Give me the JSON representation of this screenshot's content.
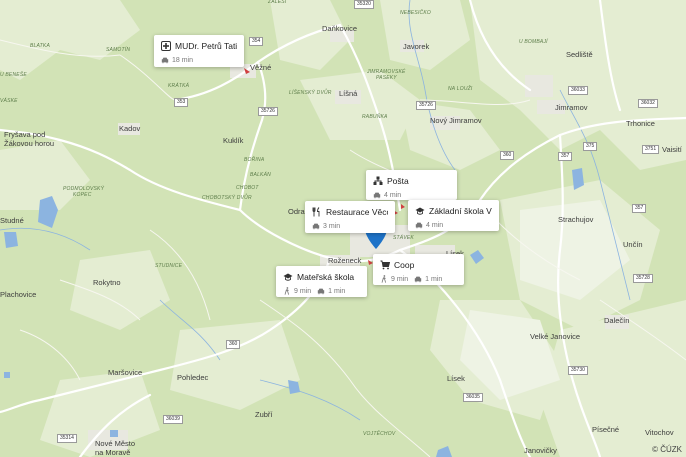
{
  "towns": [
    {
      "id": "dankovice",
      "text": "Daňkovice"
    },
    {
      "id": "javorek",
      "text": "Javorek"
    },
    {
      "id": "sedliste",
      "text": "Sedliště"
    },
    {
      "id": "kadov",
      "text": "Kadov"
    },
    {
      "id": "liskaovice",
      "text": "Líšná"
    },
    {
      "id": "novy-jimramov",
      "text": "Nový Jimramov"
    },
    {
      "id": "jimramov",
      "text": "Jimramov"
    },
    {
      "id": "trhonice",
      "text": "Trhonice"
    },
    {
      "id": "vaisiti",
      "text": "Vaisití"
    },
    {
      "id": "frysava",
      "text": "Fryšava pod"
    },
    {
      "id": "zakova",
      "text": "Žákovou horou"
    },
    {
      "id": "kuklik",
      "text": "Kuklík"
    },
    {
      "id": "odra",
      "text": "Odra"
    },
    {
      "id": "strachujov",
      "text": "Strachujov"
    },
    {
      "id": "uncin",
      "text": "Unčín"
    },
    {
      "id": "rokytno",
      "text": "Rokytno"
    },
    {
      "id": "plachovice",
      "text": "Plachovice"
    },
    {
      "id": "studne",
      "text": "Studné"
    },
    {
      "id": "rozenecky",
      "text": "Roženeck"
    },
    {
      "id": "lisek-top",
      "text": "Lísek"
    },
    {
      "id": "lisek",
      "text": "Lísek"
    },
    {
      "id": "velke-janovice",
      "text": "Velké Janovice"
    },
    {
      "id": "dalecin",
      "text": "Dalečín"
    },
    {
      "id": "marsovice",
      "text": "Maršovice"
    },
    {
      "id": "pohledec",
      "text": "Pohledec"
    },
    {
      "id": "zubri",
      "text": "Zubří"
    },
    {
      "id": "nove-mesto",
      "text": "Nové Město"
    },
    {
      "id": "na-morave",
      "text": "na Moravě"
    },
    {
      "id": "janovicky",
      "text": "Janovičky"
    },
    {
      "id": "pisecne",
      "text": "Písečné"
    },
    {
      "id": "vitochov",
      "text": "Vitochov"
    },
    {
      "id": "vezne",
      "text": "Věžné"
    }
  ],
  "areas": [
    {
      "id": "samotin",
      "text": "SAMOTÍN"
    },
    {
      "id": "blatka",
      "text": "BLATKA"
    },
    {
      "id": "zalesi",
      "text": "ZÁLESÍ"
    },
    {
      "id": "nebesicko",
      "text": "NEBESIČKO"
    },
    {
      "id": "jimram-pasek",
      "text": "JIMRAMOVSKÉ"
    },
    {
      "id": "jimram-pasek2",
      "text": "PASEKY"
    },
    {
      "id": "na-louzi",
      "text": "NA LOUŽI"
    },
    {
      "id": "lisenske",
      "text": "LÍŠENSKÝ DVŮR"
    },
    {
      "id": "rabunka",
      "text": "RABUŇKA"
    },
    {
      "id": "krátká",
      "text": "KRÁTKÁ"
    },
    {
      "id": "borina",
      "text": "BOŘINA"
    },
    {
      "id": "balkan",
      "text": "BALKÁN"
    },
    {
      "id": "chobot",
      "text": "CHOBOT"
    },
    {
      "id": "chobot-dvur",
      "text": "CHOBOTSKÝ DVŮR"
    },
    {
      "id": "podmol",
      "text": "PODMOLOVSKÝ"
    },
    {
      "id": "podmol2",
      "text": "KOPEC"
    },
    {
      "id": "stavek",
      "text": "STÁVEK"
    },
    {
      "id": "studnice",
      "text": "STUDNICE"
    },
    {
      "id": "vojtechov",
      "text": "VOJTĚCHOV"
    },
    {
      "id": "u-bombaji",
      "text": "U BOMBAJÍ"
    },
    {
      "id": "u-beneše",
      "text": "U BENEŠE"
    },
    {
      "id": "vaske",
      "text": "VÁSKE"
    }
  ],
  "roads": [
    {
      "id": "r354",
      "text": "354"
    },
    {
      "id": "r353",
      "text": "353"
    },
    {
      "id": "r35726",
      "text": "35726"
    },
    {
      "id": "r35726b",
      "text": "35726"
    },
    {
      "id": "r360a",
      "text": "360"
    },
    {
      "id": "r360b",
      "text": "360"
    },
    {
      "id": "r357a",
      "text": "357"
    },
    {
      "id": "r357b",
      "text": "357"
    },
    {
      "id": "r375",
      "text": "375"
    },
    {
      "id": "r3751",
      "text": "3751"
    },
    {
      "id": "r36033",
      "text": "36033"
    },
    {
      "id": "r36032",
      "text": "36032"
    },
    {
      "id": "r35728",
      "text": "35728"
    },
    {
      "id": "r35730",
      "text": "35730"
    },
    {
      "id": "r36035",
      "text": "36035"
    },
    {
      "id": "r36039",
      "text": "36039"
    },
    {
      "id": "r35314",
      "text": "35314"
    },
    {
      "id": "r35320",
      "text": "35320"
    }
  ],
  "pois": [
    {
      "id": "doctor",
      "icon": "medical-cross-icon",
      "title": "MUDr. Petrů Tati...",
      "meta": [
        {
          "icon": "car-icon",
          "text": "18 min"
        }
      ]
    },
    {
      "id": "posta",
      "icon": "post-office-icon",
      "title": "Pošta",
      "meta": [
        {
          "icon": "car-icon",
          "text": "4 min"
        }
      ]
    },
    {
      "id": "restaurace",
      "icon": "restaurant-icon",
      "title": "Restaurace Věcov",
      "meta": [
        {
          "icon": "car-icon",
          "text": "3 min"
        }
      ]
    },
    {
      "id": "zakladni-skola",
      "icon": "school-icon",
      "title": "Základní škola Vě...",
      "meta": [
        {
          "icon": "car-icon",
          "text": "4 min"
        }
      ]
    },
    {
      "id": "coop",
      "icon": "shopping-cart-icon",
      "title": "Coop",
      "meta": [
        {
          "icon": "walking-icon",
          "text": "9 min"
        },
        {
          "icon": "car-icon",
          "text": "1 min"
        }
      ]
    },
    {
      "id": "materska-skola",
      "icon": "school-icon",
      "title": "Mateřská škola",
      "meta": [
        {
          "icon": "walking-icon",
          "text": "9 min"
        },
        {
          "icon": "car-icon",
          "text": "1 min"
        }
      ]
    }
  ],
  "copyright": "© ČÚZK",
  "colors": {
    "forest": "#c7dca8",
    "meadow": "#dfeacb",
    "urban": "#ececec",
    "water": "#8cb4e0",
    "road": "#ffffff",
    "pin": "#1e73c8"
  }
}
